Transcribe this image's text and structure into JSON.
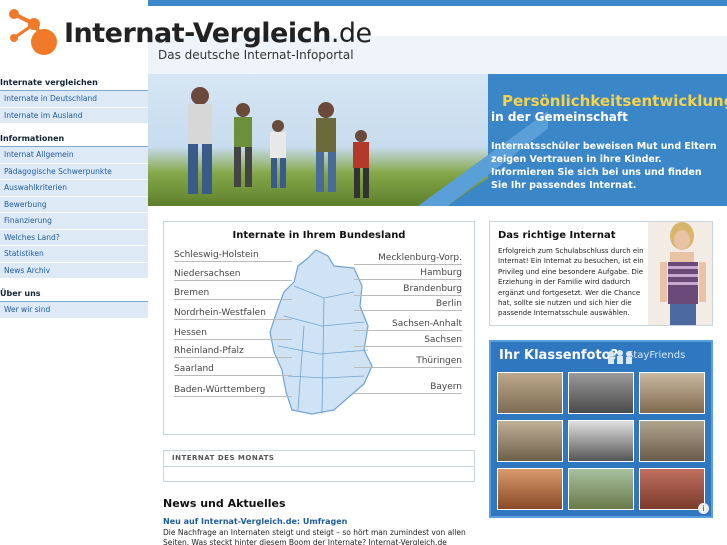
{
  "header": {
    "logo_name": "Internat-Vergleich",
    "logo_tld": ".de",
    "tagline": "Das deutsche Internat-Infoportal"
  },
  "sidebar": {
    "sections": [
      {
        "title": "Internate vergleichen",
        "items": [
          "Internate in Deutschland",
          "Internate im Ausland"
        ]
      },
      {
        "title": "Informationen",
        "items": [
          "Internat Allgemein",
          "Pädagogische Schwerpunkte",
          "Auswahlkriterien",
          "Bewerbung",
          "Finanzierung",
          "Welches Land?",
          "Statistiken",
          "News Archiv"
        ]
      },
      {
        "title": "Über uns",
        "items": [
          "Wer wir sind"
        ]
      }
    ]
  },
  "hero": {
    "title": "Persönlichkeitsentwicklung",
    "subtitle": "in der Gemeinschaft",
    "text": "Internatsschüler beweisen Mut und Eltern zeigen Vertrauen in ihre Kinder. Informieren Sie sich bei uns und finden Sie Ihr passendes Internat."
  },
  "map": {
    "title": "Internate in Ihrem Bundesland",
    "left_states": [
      "Schleswig-Holstein",
      "Niedersachsen",
      "Bremen",
      "Nordrhein-Westfalen",
      "Hessen",
      "Rheinland-Pfalz",
      "Saarland",
      "Baden-Württemberg"
    ],
    "right_states": [
      "Mecklenburg-Vorp.",
      "Hamburg",
      "Brandenburg",
      "Berlin",
      "Sachsen-Anhalt",
      "Sachsen",
      "Thüringen",
      "Bayern"
    ],
    "map_color": "#cfe3f5"
  },
  "monats": {
    "title": "INTERNAT DES MONATS"
  },
  "news": {
    "title": "News und Aktuelles",
    "link": "Neu auf Internat-Vergleich.de: Umfragen",
    "text": "Die Nachfrage an Internaten steigt und steigt – so hört man zumindest von allen Seiten. Was steckt hinter diesem Boom der Internate? Internat-Vergleich.de befragt"
  },
  "richtig": {
    "title": "Das richtige Internat",
    "text": "Erfolgreich zum Schulabschluss durch ein Internat! Ein Internat zu besuchen, ist ein Privileg und eine besondere Aufgabe. Die Erziehung in der Familie wird dadurch ergänzt und fortgesetzt. Wer die Chance hat, sollte sie nutzen und sich hier die passende Internatsschule auswählen."
  },
  "ad": {
    "headline": "Ihr Klassenfoto?",
    "brand": "StayFriends",
    "info": "i",
    "photo_count": 9
  },
  "colors": {
    "accent": "#3d88c8",
    "link": "#1e5b99",
    "sidebar_bg": "#ddeaf6",
    "hero_title": "#f6d34a",
    "logo_orange": "#f07a2a"
  }
}
